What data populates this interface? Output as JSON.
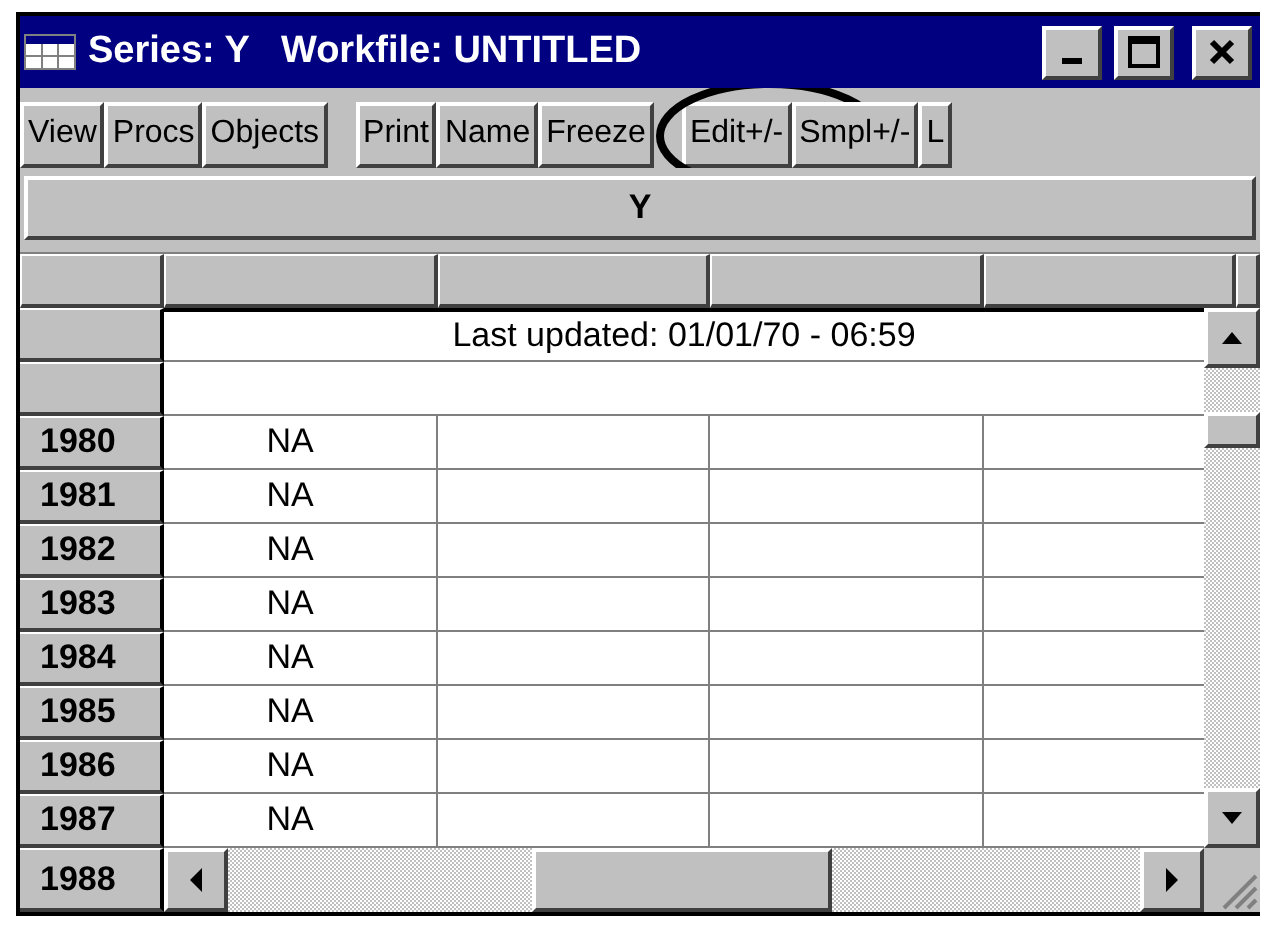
{
  "window": {
    "title": "Series: Y   Workfile: UNTITLED"
  },
  "toolbar_groups": [
    {
      "buttons": [
        {
          "label": "View",
          "circled": false
        },
        {
          "label": "Procs",
          "circled": false
        },
        {
          "label": "Objects",
          "circled": false
        }
      ]
    },
    {
      "buttons": [
        {
          "label": "Print",
          "circled": false
        },
        {
          "label": "Name",
          "circled": false
        },
        {
          "label": "Freeze",
          "circled": false
        }
      ]
    },
    {
      "buttons": [
        {
          "label": "Edit+/-",
          "circled": true
        },
        {
          "label": "Smpl+/-",
          "circled": false
        },
        {
          "label": "L",
          "circled": false
        }
      ]
    }
  ],
  "series_header": "Y",
  "last_updated": "Last updated: 01/01/70 - 06:59",
  "rows": [
    {
      "year": "1980",
      "value": "NA"
    },
    {
      "year": "1981",
      "value": "NA"
    },
    {
      "year": "1982",
      "value": "NA"
    },
    {
      "year": "1983",
      "value": "NA"
    },
    {
      "year": "1984",
      "value": "NA"
    },
    {
      "year": "1985",
      "value": "NA"
    },
    {
      "year": "1986",
      "value": "NA"
    },
    {
      "year": "1987",
      "value": "NA"
    },
    {
      "year": "1988"
    }
  ]
}
